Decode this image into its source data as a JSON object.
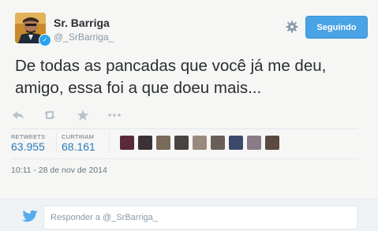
{
  "user": {
    "name": "Sr. Barriga",
    "handle": "@_SrBarriga_"
  },
  "header": {
    "follow_label": "Seguindo"
  },
  "tweet": {
    "text": "De todas as pancadas que você já me deu, amigo, essa foi a que doeu mais..."
  },
  "actions": {
    "icons": [
      "reply-icon",
      "retweet-icon",
      "favorite-icon",
      "more-icon"
    ]
  },
  "stats": {
    "retweets_label": "RETWEETS",
    "retweets_value": "63.955",
    "favorites_label": "CURTIRAM",
    "favorites_value": "68.161"
  },
  "timestamp": "10:11 - 28 de nov de 2014",
  "reply": {
    "prefix": "Responder a ",
    "handle": "@_SrBarriga_"
  },
  "colors": {
    "accent": "#4aa3e4",
    "link": "#2b7bb9",
    "muted": "#8899a6"
  }
}
